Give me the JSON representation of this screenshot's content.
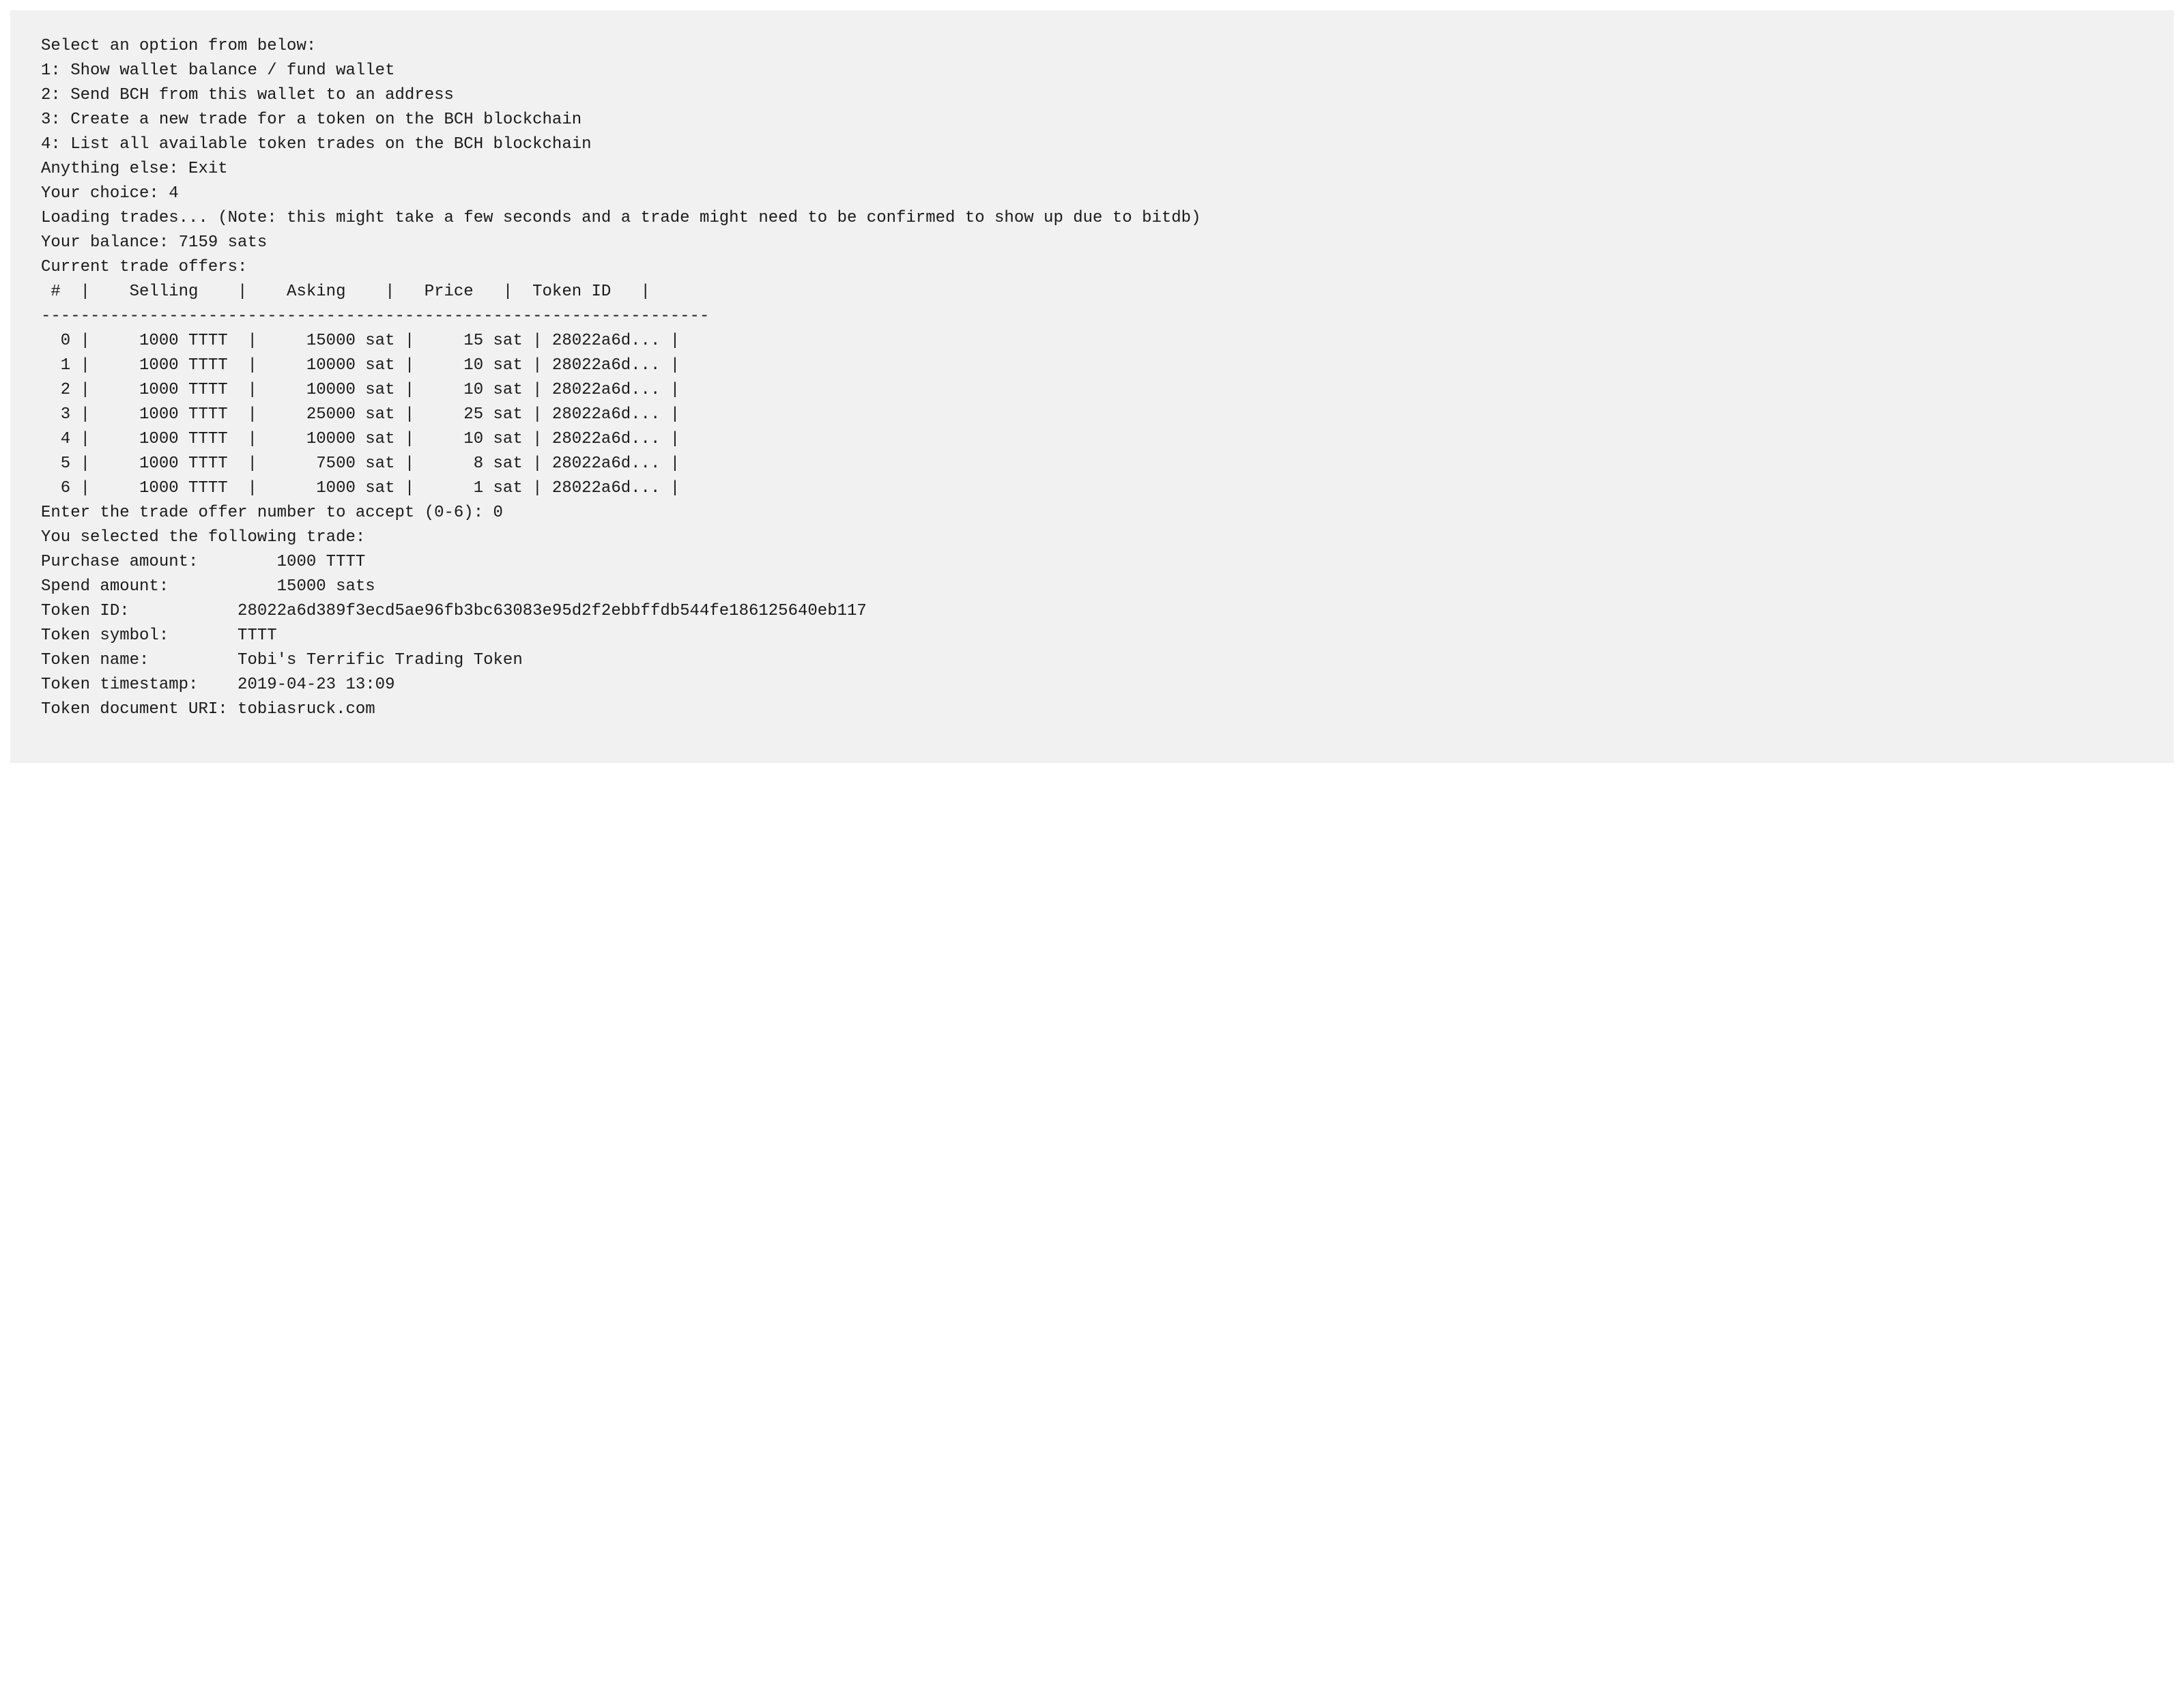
{
  "menu": {
    "prompt": "Select an option from below:",
    "options": [
      "1: Show wallet balance / fund wallet",
      "2: Send BCH from this wallet to an address",
      "3: Create a new trade for a token on the BCH blockchain",
      "4: List all available token trades on the BCH blockchain"
    ],
    "exit": "Anything else: Exit",
    "choice_label": "Your choice: ",
    "choice_value": "4"
  },
  "loading": "Loading trades... (Note: this might take a few seconds and a trade might need to be confirmed to show up due to bitdb)",
  "balance_label": "Your balance: ",
  "balance_value": "7159 sats",
  "offers_title": "Current trade offers:",
  "table": {
    "header": " #  |    Selling    |    Asking    |   Price   |  Token ID   |",
    "divider": "--------------------------------------------------------------------",
    "rows": [
      "  0 |     1000 TTTT  |     15000 sat |     15 sat | 28022a6d... |",
      "  1 |     1000 TTTT  |     10000 sat |     10 sat | 28022a6d... |",
      "  2 |     1000 TTTT  |     10000 sat |     10 sat | 28022a6d... |",
      "  3 |     1000 TTTT  |     25000 sat |     25 sat | 28022a6d... |",
      "  4 |     1000 TTTT  |     10000 sat |     10 sat | 28022a6d... |",
      "  5 |     1000 TTTT  |      7500 sat |      8 sat | 28022a6d... |",
      "  6 |     1000 TTTT  |      1000 sat |      1 sat | 28022a6d... |"
    ]
  },
  "chart_data": {
    "type": "table",
    "columns": [
      "#",
      "Selling",
      "Asking",
      "Price",
      "Token ID"
    ],
    "rows": [
      {
        "index": 0,
        "selling": "1000 TTTT",
        "asking": "15000 sat",
        "price": "15 sat",
        "token_id": "28022a6d..."
      },
      {
        "index": 1,
        "selling": "1000 TTTT",
        "asking": "10000 sat",
        "price": "10 sat",
        "token_id": "28022a6d..."
      },
      {
        "index": 2,
        "selling": "1000 TTTT",
        "asking": "10000 sat",
        "price": "10 sat",
        "token_id": "28022a6d..."
      },
      {
        "index": 3,
        "selling": "1000 TTTT",
        "asking": "25000 sat",
        "price": "25 sat",
        "token_id": "28022a6d..."
      },
      {
        "index": 4,
        "selling": "1000 TTTT",
        "asking": "10000 sat",
        "price": "10 sat",
        "token_id": "28022a6d..."
      },
      {
        "index": 5,
        "selling": "1000 TTTT",
        "asking": "7500 sat",
        "price": "8 sat",
        "token_id": "28022a6d..."
      },
      {
        "index": 6,
        "selling": "1000 TTTT",
        "asking": "1000 sat",
        "price": "1 sat",
        "token_id": "28022a6d..."
      }
    ]
  },
  "accept_prompt_label": "Enter the trade offer number to accept (0-6): ",
  "accept_prompt_value": "0",
  "selection_title": "You selected the following trade:",
  "details": {
    "purchase_amount": {
      "label": "Purchase amount:",
      "value": "1000 TTTT"
    },
    "spend_amount": {
      "label": "Spend amount:",
      "value": "15000 sats"
    },
    "token_id": {
      "label": "Token ID:",
      "value": "28022a6d389f3ecd5ae96fb3bc63083e95d2f2ebbffdb544fe186125640eb117"
    },
    "token_symbol": {
      "label": "Token symbol:",
      "value": "TTTT"
    },
    "token_name": {
      "label": "Token name:",
      "value": "Tobi's Terrific Trading Token"
    },
    "token_timestamp": {
      "label": "Token timestamp:",
      "value": "2019-04-23 13:09"
    },
    "token_uri": {
      "label": "Token document URI:",
      "value": "tobiasruck.com"
    }
  }
}
